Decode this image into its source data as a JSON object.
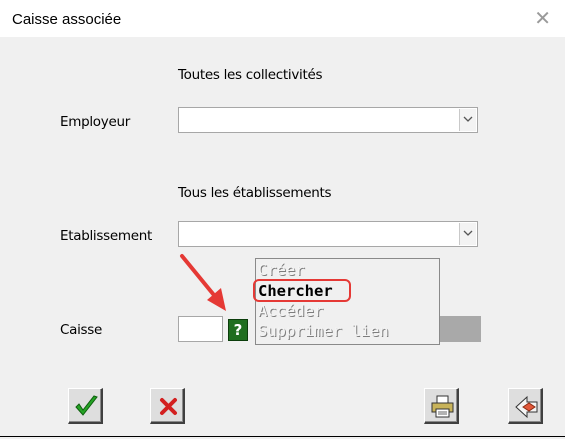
{
  "window": {
    "title": "Caisse associée",
    "close_glyph": "✕"
  },
  "form": {
    "employeur_info": "Toutes les collectivités",
    "employeur_label": "Employeur",
    "employeur_value": "",
    "etablissement_info": "Tous les établissements",
    "etablissement_label": "Etablissement",
    "etablissement_value": "",
    "caisse_label": "Caisse",
    "caisse_value": "",
    "help_glyph": "?"
  },
  "context_menu": {
    "items": [
      {
        "label": "Créer",
        "enabled": false
      },
      {
        "label": "Chercher",
        "enabled": true,
        "highlighted": true
      },
      {
        "label": "Accéder",
        "enabled": false
      },
      {
        "label": "Supprimer lien",
        "enabled": false
      }
    ]
  },
  "annotation": {
    "arrow_color": "#e53935",
    "highlight_color": "#e53935"
  },
  "toolbar": {
    "buttons": [
      {
        "name": "validate",
        "icon": "green-checkmark-icon"
      },
      {
        "name": "cancel",
        "icon": "red-x-icon"
      },
      {
        "name": "print",
        "icon": "printer-icon"
      },
      {
        "name": "back",
        "icon": "eraser-back-icon"
      }
    ]
  }
}
